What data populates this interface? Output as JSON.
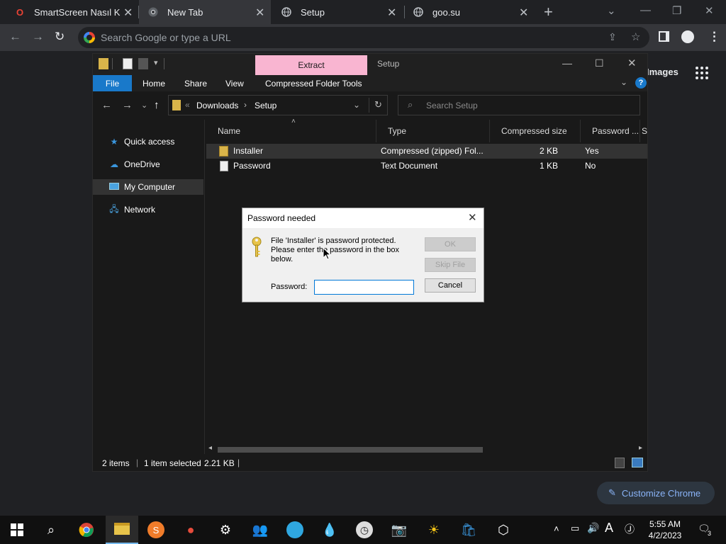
{
  "browser": {
    "tabs": [
      {
        "title": "SmartScreen Nasıl Kapa",
        "icon": "opera-red-icon"
      },
      {
        "title": "New Tab",
        "icon": "chrome-icon"
      },
      {
        "title": "Setup",
        "icon": "globe-icon"
      },
      {
        "title": "goo.su",
        "icon": "globe-icon"
      }
    ],
    "omnibox_placeholder": "Search Google or type a URL",
    "ntp_images_link": "Images",
    "customize_label": "Customize Chrome"
  },
  "explorer": {
    "title": "Setup",
    "contextual_tab": "Extract",
    "ribbon_tabs": [
      "File",
      "Home",
      "Share",
      "View",
      "Compressed Folder Tools"
    ],
    "breadcrumb": [
      "Downloads",
      "Setup"
    ],
    "search_placeholder": "Search Setup",
    "nav_items": [
      {
        "label": "Quick access",
        "icon": "star-icon"
      },
      {
        "label": "OneDrive",
        "icon": "cloud-icon"
      },
      {
        "label": "My Computer",
        "icon": "computer-icon",
        "selected": true
      },
      {
        "label": "Network",
        "icon": "network-icon"
      }
    ],
    "columns": [
      "Name",
      "Type",
      "Compressed size",
      "Password ...",
      "Si"
    ],
    "files": [
      {
        "name": "Installer",
        "type": "Compressed (zipped) Fol...",
        "size": "2 KB",
        "password": "Yes",
        "icon": "zip-folder-icon",
        "selected": true
      },
      {
        "name": "Password",
        "type": "Text Document",
        "size": "1 KB",
        "password": "No",
        "icon": "text-file-icon"
      }
    ],
    "status": {
      "items": "2 items",
      "selected": "1 item selected",
      "size": "2.21 KB"
    }
  },
  "dialog": {
    "title": "Password needed",
    "message": "File 'Installer' is password protected. Please enter the password in the box below.",
    "ok_label": "OK",
    "skip_label": "Skip File",
    "cancel_label": "Cancel",
    "password_label": "Password:",
    "password_value": ""
  },
  "taskbar": {
    "time": "5:55 AM",
    "date": "4/2/2023",
    "notification_count": "3"
  }
}
